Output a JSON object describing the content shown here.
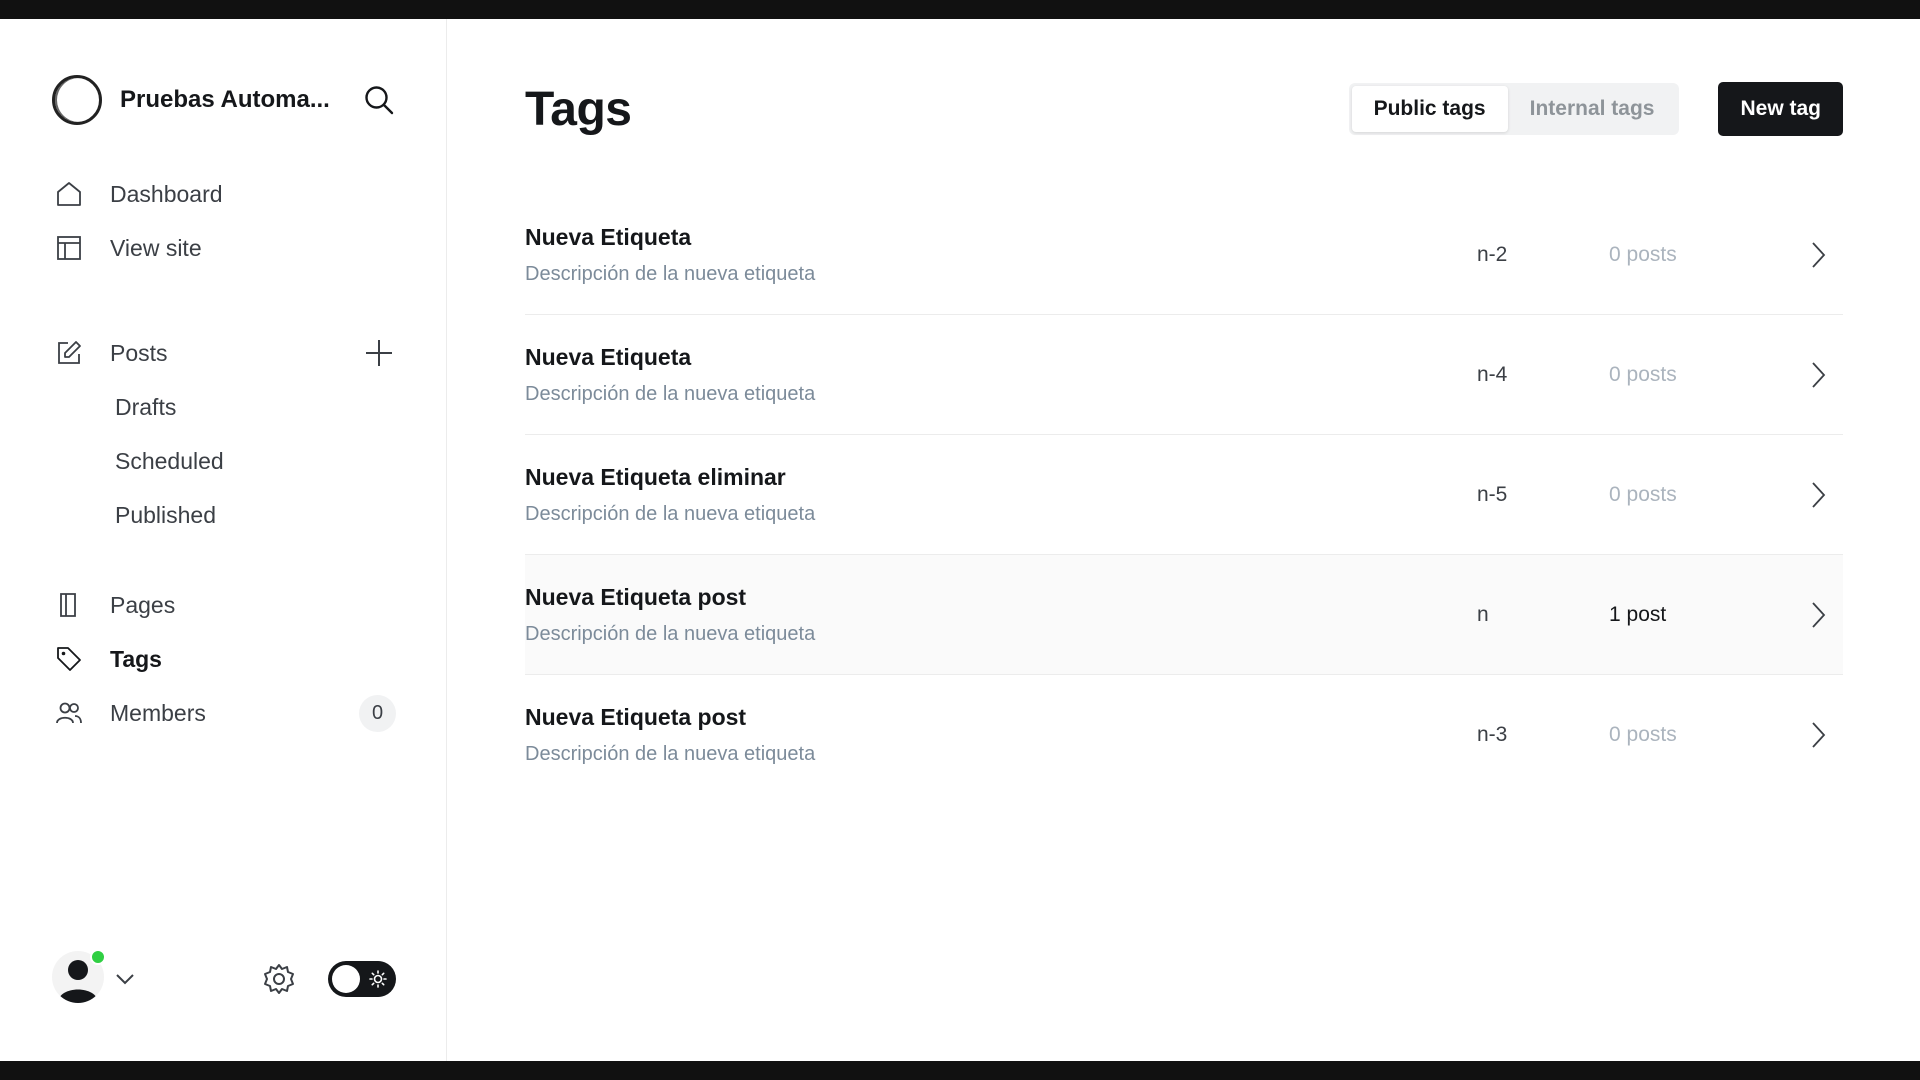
{
  "sidebar": {
    "brand_name": "Pruebas Automa...",
    "nav_main": [
      {
        "label": "Dashboard",
        "icon": "home-icon"
      },
      {
        "label": "View site",
        "icon": "layout-icon"
      }
    ],
    "posts": {
      "label": "Posts",
      "sub": [
        "Drafts",
        "Scheduled",
        "Published"
      ]
    },
    "nav_secondary": [
      {
        "label": "Pages",
        "icon": "pages-icon"
      },
      {
        "label": "Tags",
        "icon": "tag-icon",
        "active": true
      },
      {
        "label": "Members",
        "icon": "members-icon",
        "badge": "0"
      }
    ]
  },
  "header": {
    "title": "Tags",
    "public_tags_label": "Public tags",
    "internal_tags_label": "Internal tags",
    "new_tag_label": "New tag"
  },
  "tags": [
    {
      "name": "Nueva Etiqueta",
      "description": "Descripción de la nueva etiqueta",
      "slug": "n-2",
      "count": "0 posts"
    },
    {
      "name": "Nueva Etiqueta",
      "description": "Descripción de la nueva etiqueta",
      "slug": "n-4",
      "count": "0 posts"
    },
    {
      "name": "Nueva Etiqueta eliminar",
      "description": "Descripción de la nueva etiqueta",
      "slug": "n-5",
      "count": "0 posts"
    },
    {
      "name": "Nueva Etiqueta post",
      "description": "Descripción de la nueva etiqueta",
      "slug": "n",
      "count": "1 post"
    },
    {
      "name": "Nueva Etiqueta post",
      "description": "Descripción de la nueva etiqueta",
      "slug": "n-3",
      "count": "0 posts"
    }
  ],
  "colors": {
    "accent_dark": "#15171a",
    "online_dot": "#30cf43",
    "muted_text": "#7c8b9a"
  }
}
